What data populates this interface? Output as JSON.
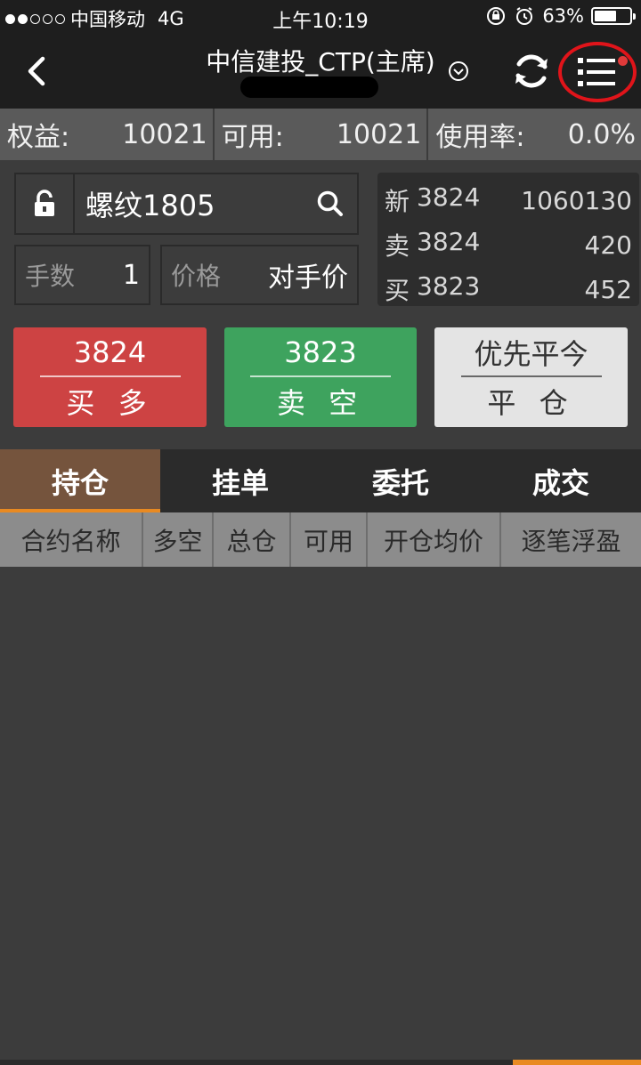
{
  "status_bar": {
    "carrier": "中国移动",
    "network": "4G",
    "time": "上午10:19",
    "battery": "63%",
    "battery_level": 0.63
  },
  "nav": {
    "title": "中信建投_CTP(主席)"
  },
  "account": {
    "equity_label": "权益:",
    "equity_value": "10021",
    "available_label": "可用:",
    "available_value": "10021",
    "usage_label": "使用率:",
    "usage_value": "0.0%"
  },
  "order": {
    "symbol": "螺纹1805",
    "qty_label": "手数",
    "qty_value": "1",
    "price_label": "价格",
    "price_value": "对手价"
  },
  "quote": {
    "rows": [
      {
        "label": "新",
        "price": "3824",
        "volume": "1060130"
      },
      {
        "label": "卖",
        "price": "3824",
        "volume": "420"
      },
      {
        "label": "买",
        "price": "3823",
        "volume": "452"
      }
    ]
  },
  "buttons": {
    "buy": {
      "price": "3824",
      "label": "买 多"
    },
    "sell": {
      "price": "3823",
      "label": "卖 空"
    },
    "close": {
      "mode": "优先平今",
      "label": "平 仓"
    }
  },
  "tabs": [
    "持仓",
    "挂单",
    "委托",
    "成交"
  ],
  "table": {
    "headers": [
      "合约名称",
      "多空",
      "总仓",
      "可用",
      "开仓均价",
      "逐笔浮盈"
    ]
  },
  "colors": {
    "buy": "#cd4343",
    "sell": "#3ea35e",
    "active_tab": "#75543d",
    "tab_accent": "#e98a22",
    "annotation_ring": "#e0141a"
  },
  "icons": {
    "back": "chevron-left-icon",
    "title_dropdown": "chevron-down-icon",
    "refresh": "refresh-icon",
    "menu": "list-menu-icon",
    "lock": "unlock-icon",
    "search": "search-icon"
  }
}
